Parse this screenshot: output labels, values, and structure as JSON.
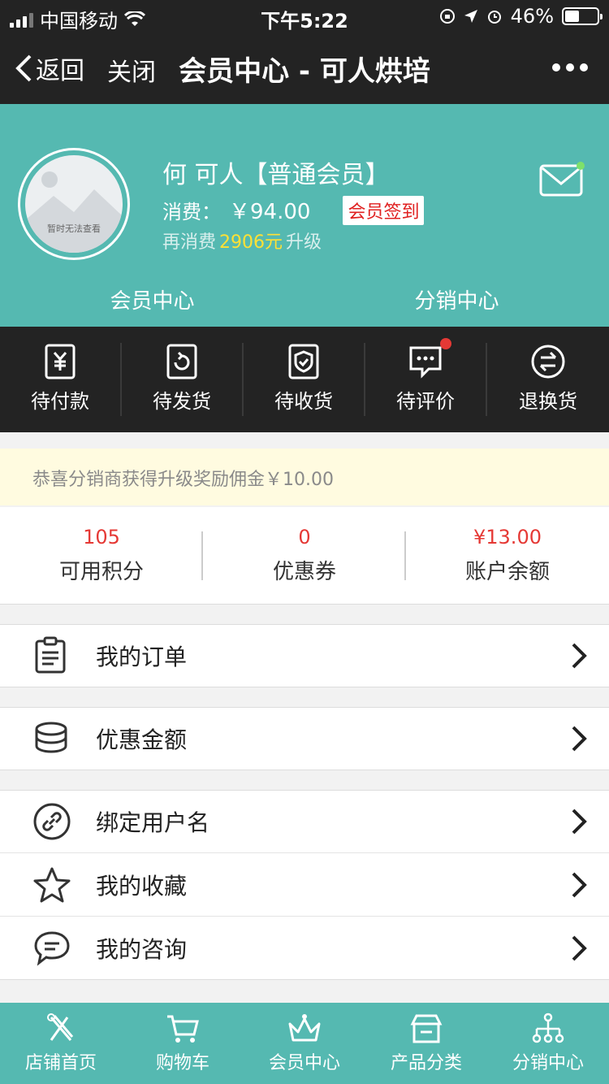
{
  "status_bar": {
    "carrier": "中国移动",
    "time": "下午5:22",
    "battery": "46%",
    "battery_level": 0.46
  },
  "nav": {
    "back_label": "返回",
    "close_label": "关闭",
    "title": "会员中心 - 可人烘培"
  },
  "member": {
    "avatar_caption": "暂时无法查看",
    "name": "何 可人【普通会员】",
    "spend_label": "消费：",
    "spend_value": "￥94.00",
    "signin_label": "会员签到",
    "upgrade_prefix": "再消费",
    "upgrade_amount": "2906元",
    "upgrade_suffix": "升级",
    "tabs": [
      "会员中心",
      "分销中心"
    ]
  },
  "orders": [
    {
      "label": "待付款",
      "icon": "payment-icon"
    },
    {
      "label": "待发货",
      "icon": "to-ship-icon"
    },
    {
      "label": "待收货",
      "icon": "to-receive-icon"
    },
    {
      "label": "待评价",
      "icon": "review-icon"
    },
    {
      "label": "退换货",
      "icon": "exchange-icon"
    }
  ],
  "notice": "恭喜分销商获得升级奖励佣金￥10.00",
  "stats": [
    {
      "value": "105",
      "label": "可用积分"
    },
    {
      "value": "0",
      "label": "优惠券"
    },
    {
      "value": "¥13.00",
      "label": "账户余额"
    }
  ],
  "menu": [
    {
      "label": "我的订单",
      "icon": "order-list-icon"
    },
    {
      "label": "优惠金额",
      "icon": "coins-icon"
    },
    {
      "label": "绑定用户名",
      "icon": "link-icon"
    },
    {
      "label": "我的收藏",
      "icon": "star-icon"
    },
    {
      "label": "我的咨询",
      "icon": "chat-icon"
    }
  ],
  "tabbar": [
    {
      "label": "店铺首页",
      "icon": "store-home-icon"
    },
    {
      "label": "购物车",
      "icon": "cart-icon"
    },
    {
      "label": "会员中心",
      "icon": "crown-icon"
    },
    {
      "label": "产品分类",
      "icon": "category-icon"
    },
    {
      "label": "分销中心",
      "icon": "distribution-icon"
    }
  ],
  "colors": {
    "teal": "#55b9b1",
    "dark": "#232323",
    "red": "#e53935",
    "yellow": "#ffe135",
    "notice_bg": "#fffbe0"
  }
}
